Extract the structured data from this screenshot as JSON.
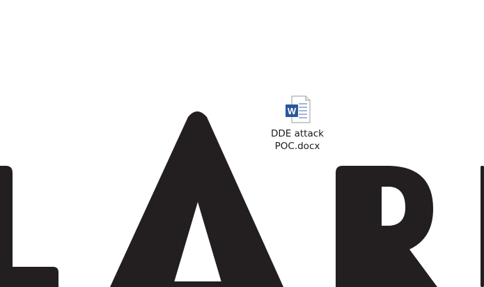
{
  "desktop": {
    "wallpaper": {
      "background_color": "#ffffff",
      "shape_color": "#231f20"
    },
    "icons": [
      {
        "label": "DDE attack POC.docx",
        "icon": "word-document-icon",
        "brand_color": "#2b579a"
      }
    ]
  }
}
